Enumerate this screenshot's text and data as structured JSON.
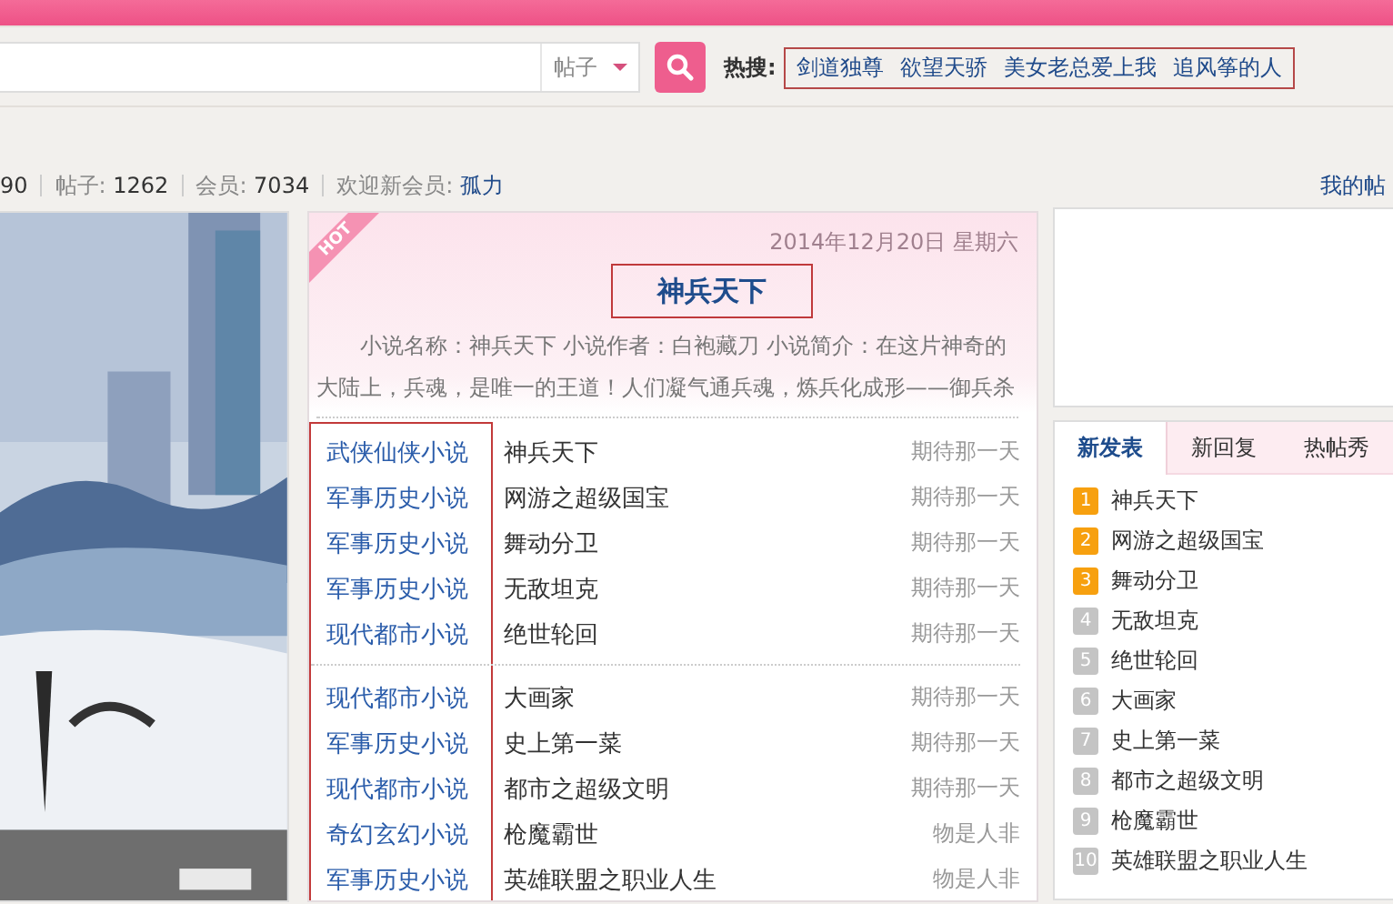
{
  "search": {
    "scope": "帖子",
    "hot_label": "热搜:",
    "hot_terms": [
      "剑道独尊",
      "欲望天骄",
      "美女老总爱上我",
      "追风筝的人"
    ]
  },
  "stats": {
    "items": [
      {
        "value": "90"
      },
      {
        "label": "帖子:",
        "value": "1262"
      },
      {
        "label": "会员:",
        "value": "7034"
      }
    ],
    "welcome_label": "欢迎新会员:",
    "new_member": "孤力",
    "my_posts": "我的帖"
  },
  "feature": {
    "badge": "HOT",
    "date": "2014年12月20日 星期六",
    "title": "神兵天下",
    "summary": "小说名称：神兵天下 小说作者：白袍藏刀 小说简介：在这片神奇的大陆上，兵魂，是唯一的王道！人们凝气通兵魂，炼兵化成形——御兵杀",
    "groups": [
      [
        {
          "category": "武侠仙侠小说",
          "title": "神兵天下",
          "note": "期待那一天"
        },
        {
          "category": "军事历史小说",
          "title": "网游之超级国宝",
          "note": "期待那一天"
        },
        {
          "category": "军事历史小说",
          "title": "舞动分卫",
          "note": "期待那一天"
        },
        {
          "category": "军事历史小说",
          "title": "无敌坦克",
          "note": "期待那一天"
        },
        {
          "category": "现代都市小说",
          "title": "绝世轮回",
          "note": "期待那一天"
        }
      ],
      [
        {
          "category": "现代都市小说",
          "title": "大画家",
          "note": "期待那一天"
        },
        {
          "category": "军事历史小说",
          "title": "史上第一菜",
          "note": "期待那一天"
        },
        {
          "category": "现代都市小说",
          "title": "都市之超级文明",
          "note": "期待那一天"
        },
        {
          "category": "奇幻玄幻小说",
          "title": "枪魔霸世",
          "note": "物是人非"
        },
        {
          "category": "军事历史小说",
          "title": "英雄联盟之职业人生",
          "note": "物是人非"
        }
      ]
    ]
  },
  "side": {
    "tabs": [
      {
        "label": "新发表",
        "selected": true
      },
      {
        "label": "新回复",
        "selected": false
      },
      {
        "label": "热帖秀",
        "selected": false
      }
    ],
    "list": [
      {
        "rank": "1",
        "title": "神兵天下",
        "color": "#f7a00f"
      },
      {
        "rank": "2",
        "title": "网游之超级国宝",
        "color": "#f7a00f"
      },
      {
        "rank": "3",
        "title": "舞动分卫",
        "color": "#f7a00f"
      },
      {
        "rank": "4",
        "title": "无敌坦克",
        "color": "#c4c4c4"
      },
      {
        "rank": "5",
        "title": "绝世轮回",
        "color": "#c4c4c4"
      },
      {
        "rank": "6",
        "title": "大画家",
        "color": "#c4c4c4"
      },
      {
        "rank": "7",
        "title": "史上第一菜",
        "color": "#c4c4c4"
      },
      {
        "rank": "8",
        "title": "都市之超级文明",
        "color": "#c4c4c4"
      },
      {
        "rank": "9",
        "title": "枪魔霸世",
        "color": "#c4c4c4"
      },
      {
        "rank": "10",
        "title": "英雄联盟之职业人生",
        "color": "#c4c4c4"
      }
    ]
  }
}
